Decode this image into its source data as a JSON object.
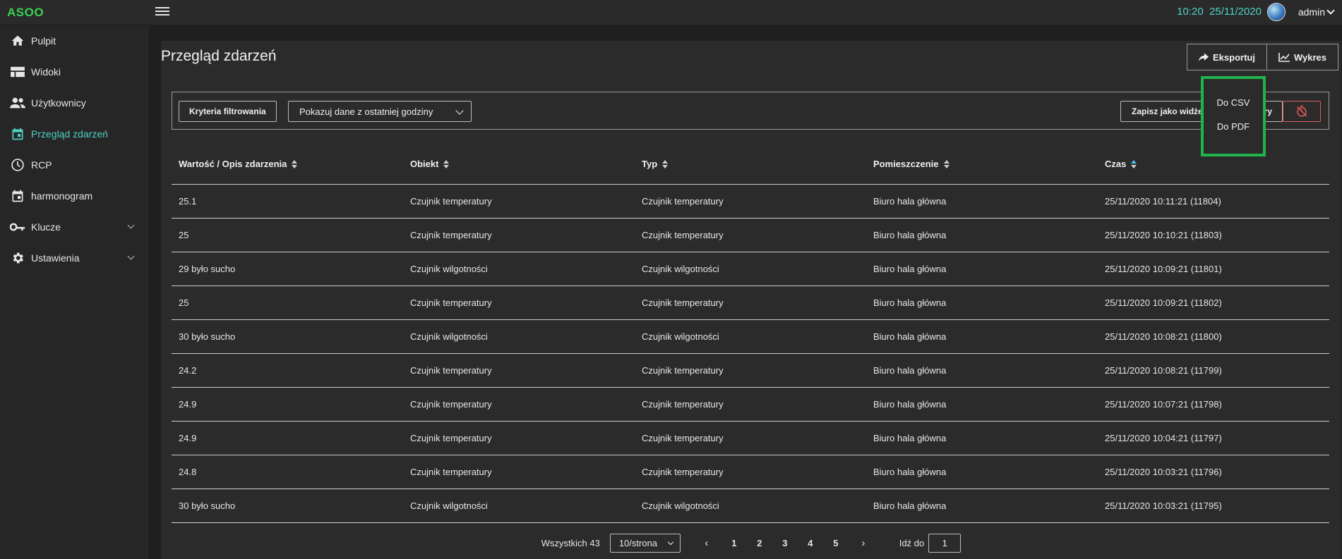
{
  "app": {
    "brand": "ASOO"
  },
  "header": {
    "time": "10:20",
    "date": "25/11/2020",
    "user": "admin"
  },
  "sidebar": {
    "items": [
      {
        "label": "Pulpit",
        "icon": "home-icon"
      },
      {
        "label": "Widoki",
        "icon": "view-icon"
      },
      {
        "label": "Użytkownicy",
        "icon": "users-icon"
      },
      {
        "label": "Przegląd zdarzeń",
        "icon": "calendar-icon",
        "active": true
      },
      {
        "label": "RCP",
        "icon": "clock-icon"
      },
      {
        "label": "harmonogram",
        "icon": "calendar-icon"
      },
      {
        "label": "Klucze",
        "icon": "key-icon",
        "expandable": true
      },
      {
        "label": "Ustawienia",
        "icon": "gear-icon",
        "expandable": true
      }
    ]
  },
  "page": {
    "title": "Przegląd zdarzeń"
  },
  "toolbar": {
    "export_label": "Eksportuj",
    "chart_label": "Wykres"
  },
  "export_menu": {
    "csv": "Do CSV",
    "pdf": "Do PDF"
  },
  "filters": {
    "criteria_label": "Kryteria filtrowania",
    "range_value": "Pokazuj dane z ostatniej godziny",
    "save_widget_label": "Zapisz jako widże",
    "hidden_button_fragment": "ry"
  },
  "table": {
    "columns": [
      "Wartość / Opis zdarzenia",
      "Obiekt",
      "Typ",
      "Pomieszczenie",
      "Czas"
    ],
    "rows": [
      [
        "25.1",
        "Czujnik temperatury",
        "Czujnik temperatury",
        "Biuro hala główna",
        "25/11/2020 10:11:21 (11804)"
      ],
      [
        "25",
        "Czujnik temperatury",
        "Czujnik temperatury",
        "Biuro hala główna",
        "25/11/2020 10:10:21 (11803)"
      ],
      [
        "29 było sucho",
        "Czujnik wilgotności",
        "Czujnik wilgotności",
        "Biuro hala główna",
        "25/11/2020 10:09:21 (11801)"
      ],
      [
        "25",
        "Czujnik temperatury",
        "Czujnik temperatury",
        "Biuro hala główna",
        "25/11/2020 10:09:21 (11802)"
      ],
      [
        "30 było sucho",
        "Czujnik wilgotności",
        "Czujnik wilgotności",
        "Biuro hala główna",
        "25/11/2020 10:08:21 (11800)"
      ],
      [
        "24.2",
        "Czujnik temperatury",
        "Czujnik temperatury",
        "Biuro hala główna",
        "25/11/2020 10:08:21 (11799)"
      ],
      [
        "24.9",
        "Czujnik temperatury",
        "Czujnik temperatury",
        "Biuro hala główna",
        "25/11/2020 10:07:21 (11798)"
      ],
      [
        "24.9",
        "Czujnik temperatury",
        "Czujnik temperatury",
        "Biuro hala główna",
        "25/11/2020 10:04:21 (11797)"
      ],
      [
        "24.8",
        "Czujnik temperatury",
        "Czujnik temperatury",
        "Biuro hala główna",
        "25/11/2020 10:03:21 (11796)"
      ],
      [
        "30 było sucho",
        "Czujnik wilgotności",
        "Czujnik wilgotności",
        "Biuro hala główna",
        "25/11/2020 10:03:21 (11795)"
      ]
    ]
  },
  "pagination": {
    "total_label": "Wszystkich 43",
    "page_size": "10/strona",
    "pages": [
      "1",
      "2",
      "3",
      "4",
      "5"
    ],
    "goto_label": "Idź do",
    "goto_value": "1"
  },
  "colors": {
    "accent": "#4fd1c5",
    "brand": "#39d353",
    "highlight": "#21b24b",
    "danger": "#e05b5b"
  }
}
